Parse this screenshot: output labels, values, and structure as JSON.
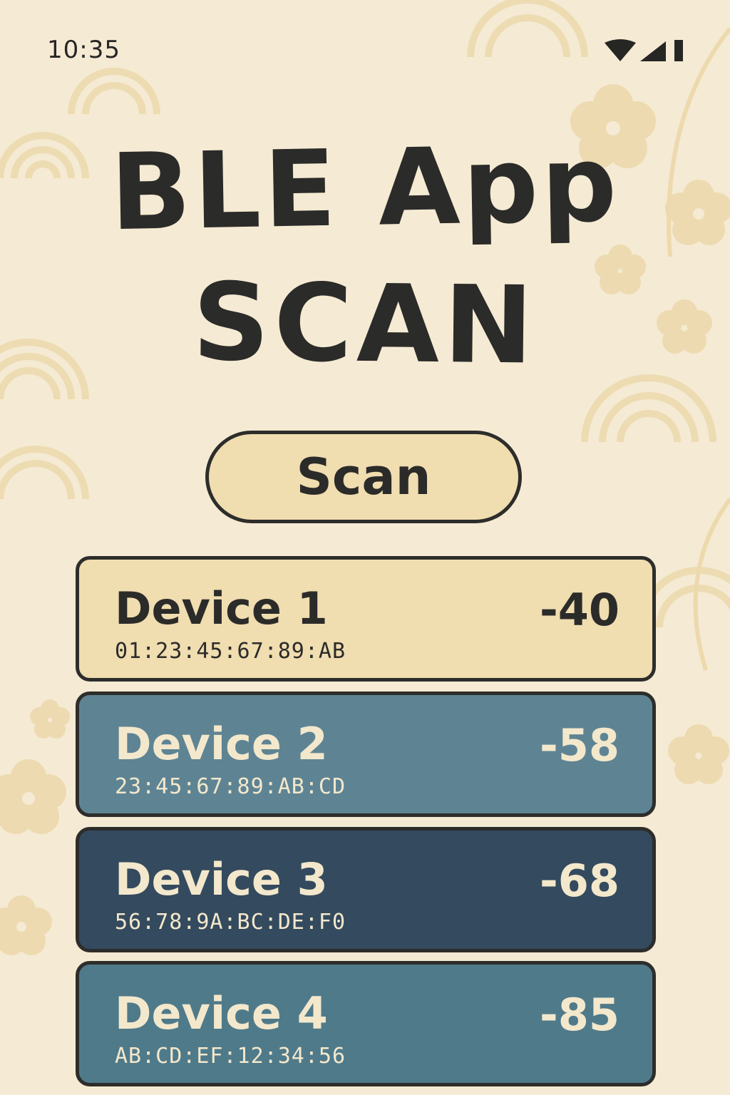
{
  "status_bar": {
    "time": "10:35",
    "icons": [
      "wifi-icon",
      "cellular-signal-icon",
      "battery-icon"
    ]
  },
  "title": {
    "line1": "BLE App",
    "line2": "SCAN"
  },
  "scan_button": {
    "label": "Scan"
  },
  "devices": [
    {
      "name": "Device 1",
      "mac": "01:23:45:67:89:AB",
      "rssi": "-40"
    },
    {
      "name": "Device 2",
      "mac": "23:45:67:89:AB:CD",
      "rssi": "-58"
    },
    {
      "name": "Device 3",
      "mac": "56:78:9A:BC:DE:F0",
      "rssi": "-68"
    },
    {
      "name": "Device 4",
      "mac": "AB:CD:EF:12:34:56",
      "rssi": "-85"
    }
  ],
  "colors": {
    "background": "#f5ead3",
    "ink": "#2b2b29",
    "scan_button_fill": "#f0ddb0",
    "device_1_fill": "#f0ddb0",
    "device_2_fill": "#5e8494",
    "device_3_fill": "#344a5e",
    "device_4_fill": "#4f7a8a",
    "light_text": "#f3e8cc"
  }
}
